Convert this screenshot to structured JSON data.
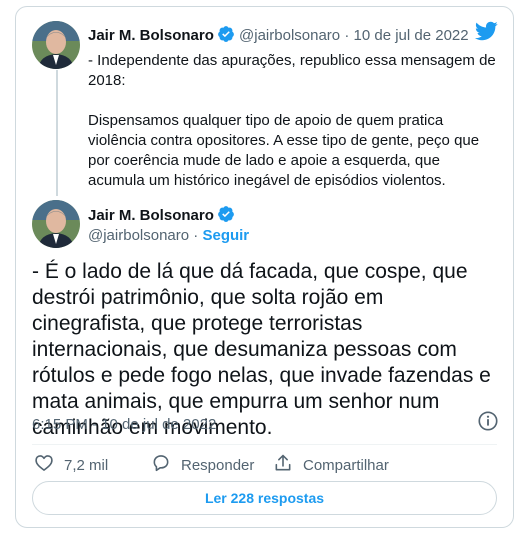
{
  "quoted_tweet": {
    "author_name": "Jair M. Bolsonaro",
    "handle": "@jairbolsonaro",
    "separator": " · ",
    "date": "10 de jul de 2022",
    "paragraphs": [
      "- Independente das apurações, republico essa mensagem de 2018:",
      "Dispensamos qualquer tipo de apoio de quem pratica violência contra opositores. A esse tipo de gente, peço que por coerência mude de lado e apoie a esquerda, que acumula um histórico inegável de episódios violentos."
    ]
  },
  "main_tweet": {
    "author_name": "Jair M. Bolsonaro",
    "handle": "@jairbolsonaro",
    "separator": " · ",
    "follow_label": "Seguir",
    "text": "- É o lado de lá que dá facada, que cospe, que destrói patrimônio, que solta rojão em cinegrafista, que protege terroristas internacionais, que desumaniza pessoas com rótulos e pede fogo nelas, que invade fazendas e mata animais, que empurra um senhor num caminhão em movimento.",
    "timestamp": "6:15 PM - 10 de jul de 2022"
  },
  "actions": {
    "likes_count": "7,2 mil",
    "reply_label": "Responder",
    "share_label": "Compartilhar"
  },
  "replies_button_label": "Ler 228 respostas",
  "icons": {
    "brand": "twitter-bird-icon",
    "verified": "verified-badge-icon",
    "info": "info-icon",
    "like": "heart-icon",
    "reply": "speech-bubble-icon",
    "share": "share-upload-icon"
  },
  "colors": {
    "accent": "#1d9bf0",
    "text": "#0f1419",
    "muted": "#536471",
    "border": "#cfd9de"
  }
}
